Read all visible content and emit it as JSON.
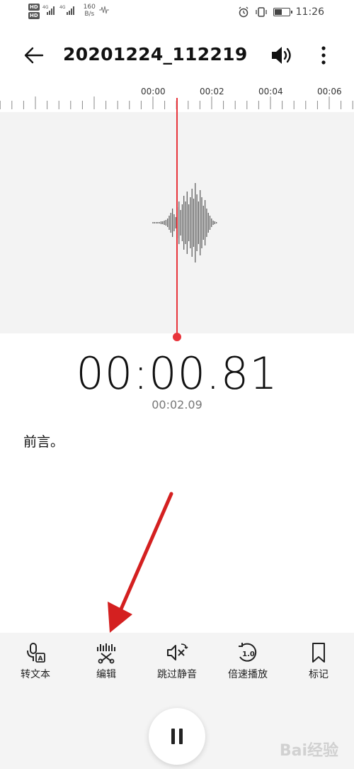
{
  "status_bar": {
    "hd1": "HD",
    "hd2": "HD",
    "net1": "4G",
    "net2": "4G",
    "speed_value": "160",
    "speed_unit": "B/s",
    "time": "11:26"
  },
  "header": {
    "title": "20201224_112219"
  },
  "timeline": {
    "ticks": [
      "00:00",
      "00:02",
      "00:04",
      "00:06"
    ]
  },
  "playback": {
    "elapsed": "00:00.81",
    "total": "00:02.09"
  },
  "transcript": {
    "text": "前言。"
  },
  "toolbar": {
    "items": [
      {
        "label": "转文本",
        "icon": "speech-to-text-icon"
      },
      {
        "label": "编辑",
        "icon": "edit-cut-icon"
      },
      {
        "label": "跳过静音",
        "icon": "skip-silence-icon"
      },
      {
        "label": "倍速播放",
        "icon": "speed-play-icon"
      },
      {
        "label": "标记",
        "icon": "bookmark-icon"
      }
    ],
    "speed_badge": "1.0"
  },
  "watermark": {
    "text": "Bai经验"
  },
  "colors": {
    "accent_red": "#e8343b",
    "wave_bg": "#f3f3f3",
    "toolbar_bg": "#f4f4f4"
  }
}
